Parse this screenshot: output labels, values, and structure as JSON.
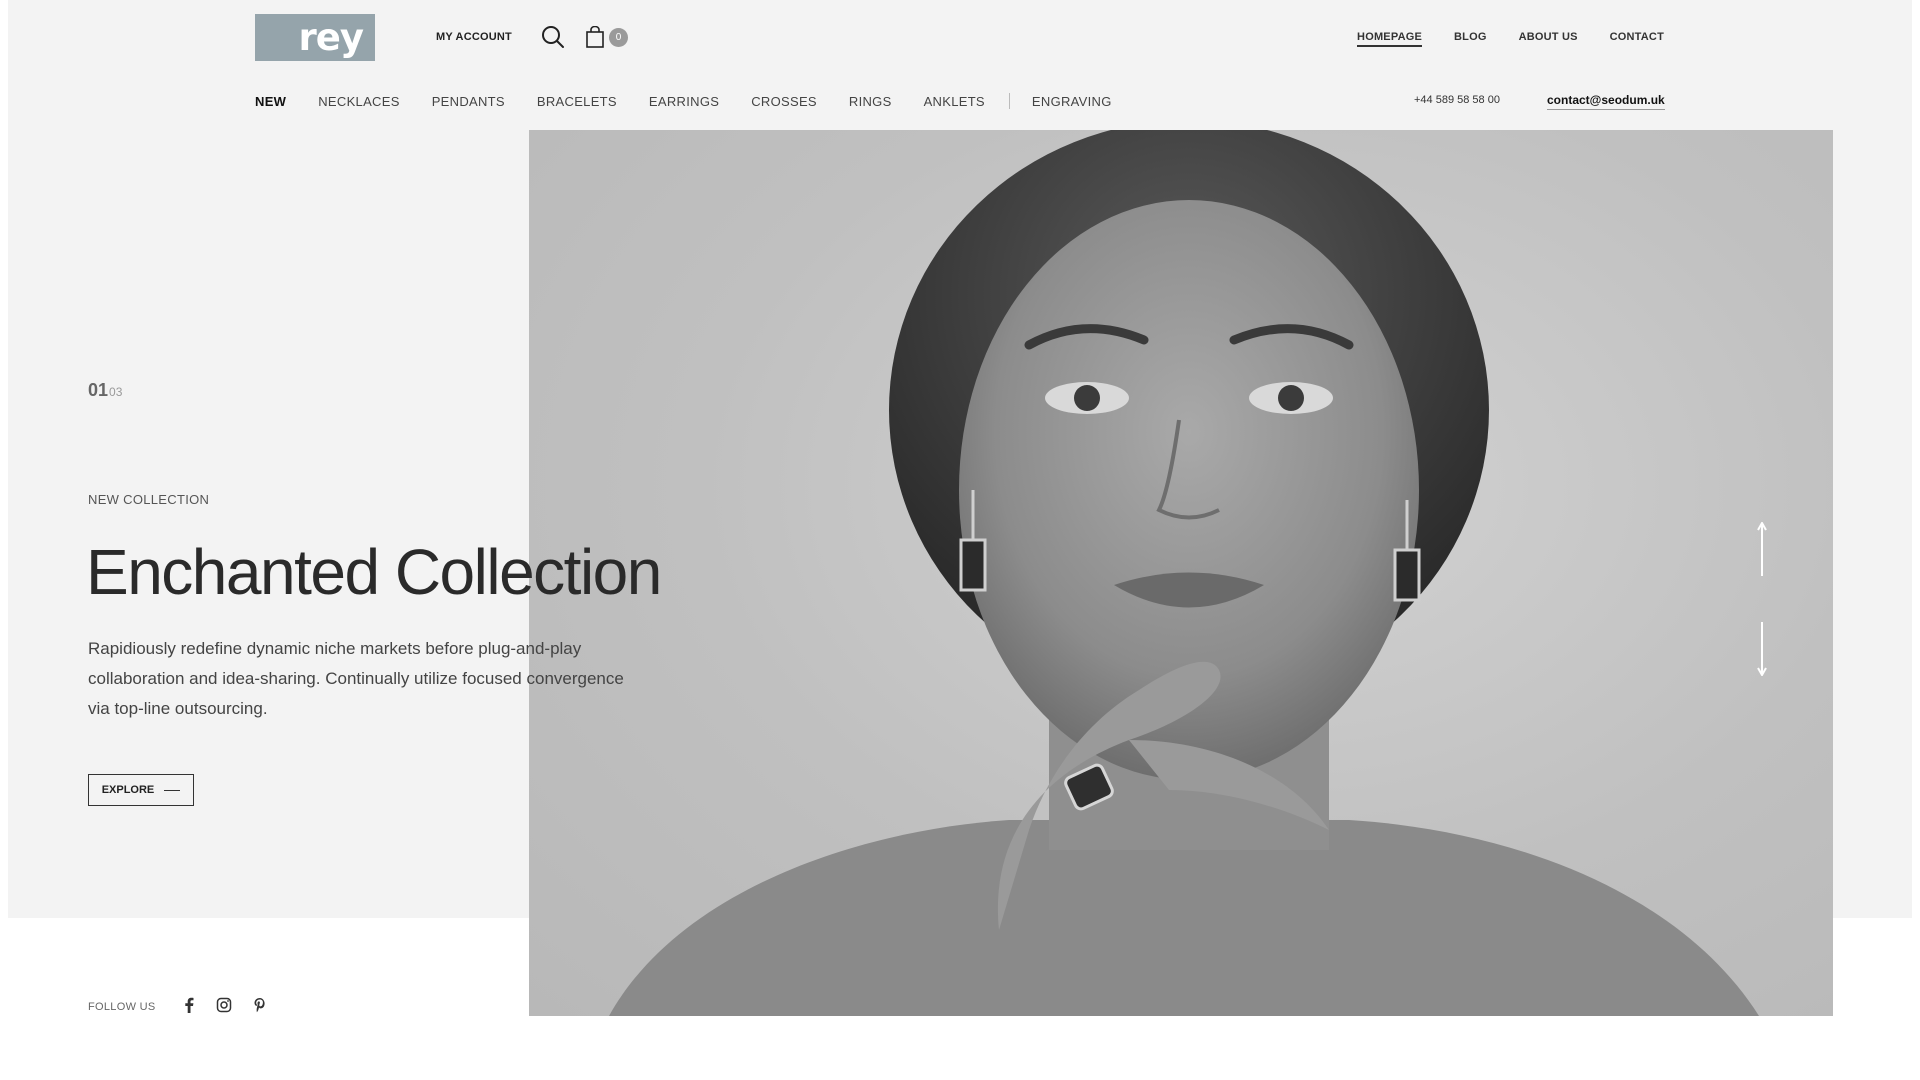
{
  "brand": {
    "logo_text": "rey",
    "logo_color": "#95a4ab"
  },
  "topbar": {
    "my_account": "MY ACCOUNT",
    "search_icon": "search-icon",
    "cart_icon": "shopping-bag-icon",
    "cart_count": "0"
  },
  "main_nav": {
    "items": [
      {
        "label": "HOMEPAGE",
        "active": true
      },
      {
        "label": "BLOG"
      },
      {
        "label": "ABOUT US"
      },
      {
        "label": "CONTACT"
      }
    ]
  },
  "category_nav": {
    "items": [
      {
        "label": "NEW",
        "active": true
      },
      {
        "label": "NECKLACES"
      },
      {
        "label": "PENDANTS"
      },
      {
        "label": "BRACELETS"
      },
      {
        "label": "EARRINGS"
      },
      {
        "label": "CROSSES"
      },
      {
        "label": "RINGS"
      },
      {
        "label": "ANKLETS"
      },
      {
        "label": "ENGRAVING"
      }
    ]
  },
  "contact": {
    "phone": "+44 589 58 58 00",
    "email": "contact@seodum.uk"
  },
  "hero": {
    "slide_current": "01",
    "slide_total": "03",
    "eyebrow": "NEW COLLECTION",
    "title": "Enchanted Collection",
    "description": "Rapidiously redefine dynamic niche markets before plug-and-play collaboration and idea-sharing. Continually utilize focused convergence via top-line outsourcing.",
    "button_label": "EXPLORE",
    "image_icon": "portrait-photo",
    "nav_up_icon": "arrow-up-icon",
    "nav_down_icon": "arrow-down-icon"
  },
  "footer": {
    "follow_label": "FOLLOW US",
    "social": [
      "facebook-icon",
      "instagram-icon",
      "pinterest-icon"
    ]
  }
}
